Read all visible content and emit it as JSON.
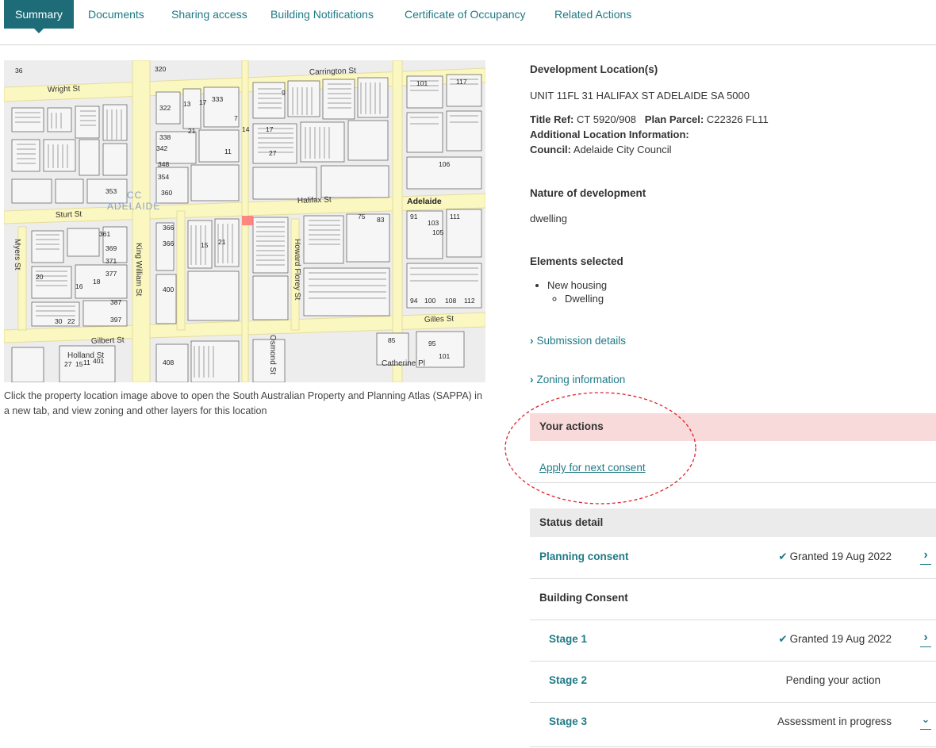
{
  "tabs": [
    {
      "label": "Summary",
      "active": true
    },
    {
      "label": "Documents"
    },
    {
      "label": "Sharing access"
    },
    {
      "label": "Building Notifications"
    },
    {
      "label": "Certificate of Occupancy"
    },
    {
      "label": "Related Actions"
    }
  ],
  "map": {
    "streets": {
      "wright": "Wright St",
      "carrington": "Carrington St",
      "halifax": "Halifax St",
      "sturt": "Sturt St",
      "gilles": "Gilles St",
      "gilbert": "Gilbert St",
      "king_william": "King William St",
      "howard_florey": "Howard Florey St",
      "myers": "Myers St",
      "osmond": "Osmond St",
      "holland": "Holland St",
      "catherine": "Catherine Pl"
    },
    "area_labels": {
      "cc": "CC",
      "adelaide_light": "ADELAIDE",
      "adelaide_bold": "Adelaide"
    },
    "lot_numbers": [
      "36",
      "320",
      "322",
      "13",
      "17",
      "333",
      "9",
      "101",
      "117",
      "338",
      "21",
      "14",
      "17",
      "7",
      "342",
      "11",
      "27",
      "348",
      "354",
      "360",
      "353",
      "366",
      "366",
      "15",
      "21",
      "361",
      "369",
      "371",
      "377",
      "387",
      "397",
      "400",
      "408",
      "401",
      "27",
      "15",
      "11",
      "18",
      "20",
      "16",
      "22",
      "30",
      "103",
      "111",
      "105",
      "91",
      "75",
      "83",
      "95",
      "85",
      "101",
      "106",
      "112",
      "100",
      "108",
      "94"
    ],
    "note": "Click the property location image above to open the South Australian Property and Planning Atlas (SAPPA) in a new   tab, and view zoning and other layers for this location"
  },
  "details": {
    "location_heading": "Development Location(s)",
    "address": "UNIT 11FL 31 HALIFAX ST ADELAIDE SA 5000",
    "title_ref_label": "Title Ref:",
    "title_ref": "CT 5920/908",
    "plan_parcel_label": "Plan Parcel:",
    "plan_parcel": "C22326 FL11",
    "additional_label": "Additional Location Information:",
    "council_label": "Council:",
    "council": "Adelaide City Council",
    "nature_heading": "Nature of development",
    "nature": "dwelling",
    "elements_heading": "Elements selected",
    "element": "New housing",
    "sub_element": "Dwelling",
    "submission_link": "Submission details",
    "zoning_link": "Zoning information"
  },
  "actions": {
    "heading": "Your actions",
    "apply_link": "Apply for next consent"
  },
  "status": {
    "heading": "Status detail",
    "planning": {
      "name": "Planning consent",
      "status": "Granted 19 Aug 2022",
      "icon": "check-icon"
    },
    "building_label": "Building Consent",
    "stages": [
      {
        "name": "Stage 1",
        "status": "Granted 19 Aug 2022",
        "icon": "check-icon",
        "arrow": "chevron-right-icon"
      },
      {
        "name": "Stage 2",
        "status": "Pending your action"
      },
      {
        "name": "Stage 3",
        "status": "Assessment in progress",
        "arrow": "chevron-down-icon"
      }
    ]
  },
  "colors": {
    "teal": "#1d6c78",
    "link": "#1f7a85",
    "actions_bg": "#f8dada",
    "status_bg": "#ebebeb",
    "callout": "#e0202a",
    "road": "#fbf7c0"
  }
}
